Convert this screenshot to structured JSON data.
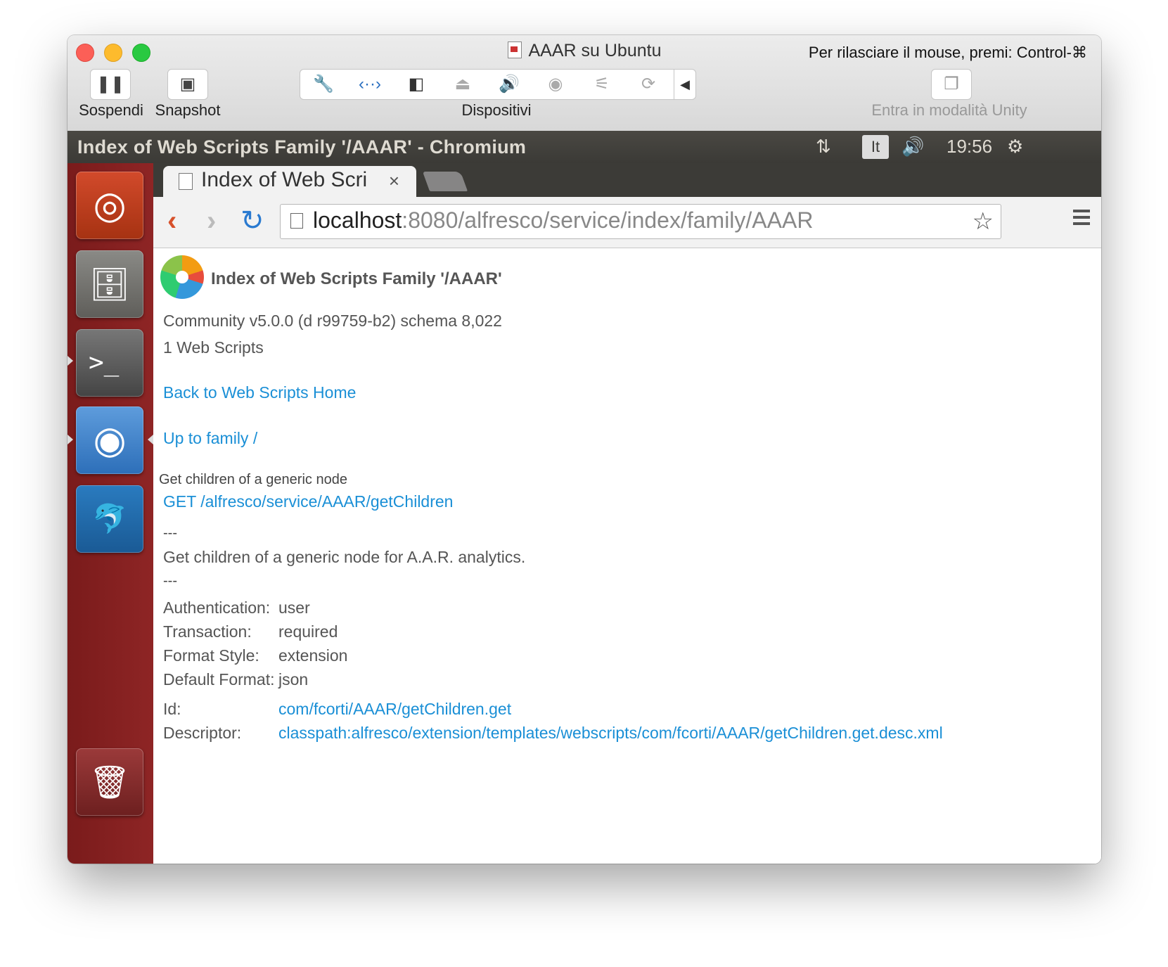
{
  "mac": {
    "window_title": "AAAR su Ubuntu",
    "release_hint": "Per rilasciare il mouse, premi: Control-⌘",
    "pause_label": "Sospendi",
    "snapshot_label": "Snapshot",
    "devices_label": "Dispositivi",
    "unity_label": "Entra in modalità Unity"
  },
  "ubuntu": {
    "panel_title": "Index of Web Scripts Family '/AAAR' - Chromium",
    "keyboard_layout": "It",
    "clock": "19:56"
  },
  "browser": {
    "tab_title": "Index of Web Scripts Family '/AAAR'",
    "tab_title_visible": "Index of Web Scri",
    "url_host": "localhost",
    "url_path": ":8080/alfresco/service/index/family/AAAR"
  },
  "page": {
    "title": "Index of Web Scripts Family '/AAAR'",
    "version": "Community v5.0.0 (d r99759-b2) schema 8,022",
    "count": "1 Web Scripts",
    "back_link": "Back to Web Scripts Home",
    "up_link": "Up to family /",
    "script": {
      "short_name": "Get children of a generic node",
      "url": "GET /alfresco/service/AAAR/getChildren",
      "separator": "---",
      "description": "Get children of a generic node for A.A.R. analytics.",
      "props": [
        {
          "label": "Authentication:",
          "value": "user"
        },
        {
          "label": "Transaction:",
          "value": "required"
        },
        {
          "label": "Format Style:",
          "value": "extension"
        },
        {
          "label": "Default Format:",
          "value": "json"
        }
      ],
      "id_label": "Id:",
      "id_value": "com/fcorti/AAAR/getChildren.get",
      "descriptor_label": "Descriptor:",
      "descriptor_value": "classpath:alfresco/extension/templates/webscripts/com/fcorti/AAAR/getChildren.get.desc.xml"
    }
  }
}
